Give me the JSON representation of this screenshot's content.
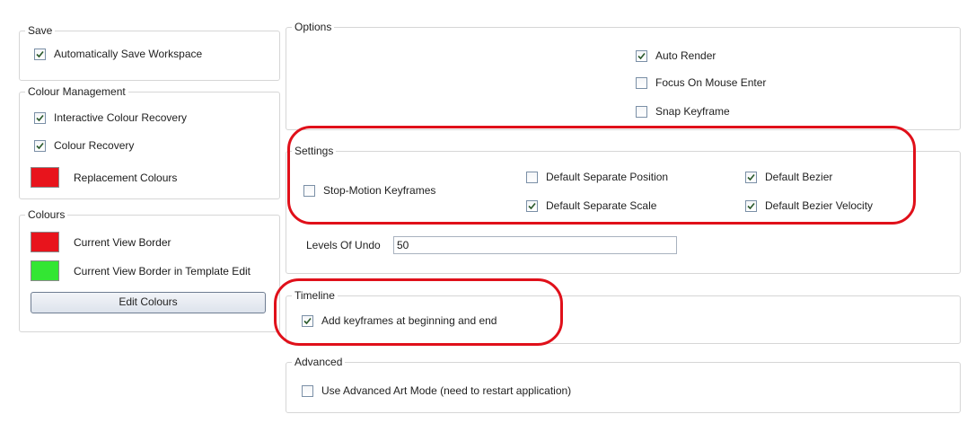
{
  "save": {
    "title": "Save",
    "auto_save_label": "Automatically Save Workspace",
    "auto_save_checked": true
  },
  "colour_management": {
    "title": "Colour Management",
    "interactive_recovery_label": "Interactive Colour Recovery",
    "interactive_recovery_checked": true,
    "colour_recovery_label": "Colour Recovery",
    "colour_recovery_checked": true,
    "replacement_label": "Replacement Colours",
    "replacement_color": "#e8141c"
  },
  "colours": {
    "title": "Colours",
    "current_view_border_label": "Current View Border",
    "current_view_border_color": "#e8141c",
    "template_edit_border_label": "Current View Border in Template Edit",
    "template_edit_border_color": "#33e633",
    "edit_button_label": "Edit Colours"
  },
  "options": {
    "title": "Options",
    "auto_render_label": "Auto Render",
    "auto_render_checked": true,
    "focus_mouse_label": "Focus On Mouse Enter",
    "focus_mouse_checked": false,
    "snap_keyframe_label": "Snap Keyframe",
    "snap_keyframe_checked": false
  },
  "settings": {
    "title": "Settings",
    "stop_motion_label": "Stop-Motion Keyframes",
    "stop_motion_checked": false,
    "separate_position_label": "Default Separate Position",
    "separate_position_checked": false,
    "separate_scale_label": "Default Separate Scale",
    "separate_scale_checked": true,
    "bezier_label": "Default Bezier",
    "bezier_checked": true,
    "bezier_velocity_label": "Default Bezier Velocity",
    "bezier_velocity_checked": true
  },
  "undo": {
    "label": "Levels Of Undo",
    "value": "50"
  },
  "timeline": {
    "title": "Timeline",
    "add_keyframes_label": "Add keyframes at beginning and end",
    "add_keyframes_checked": true
  },
  "advanced": {
    "title": "Advanced",
    "art_mode_label": "Use Advanced Art Mode (need to restart application)",
    "art_mode_checked": false
  },
  "highlight_color": "#e0101a"
}
